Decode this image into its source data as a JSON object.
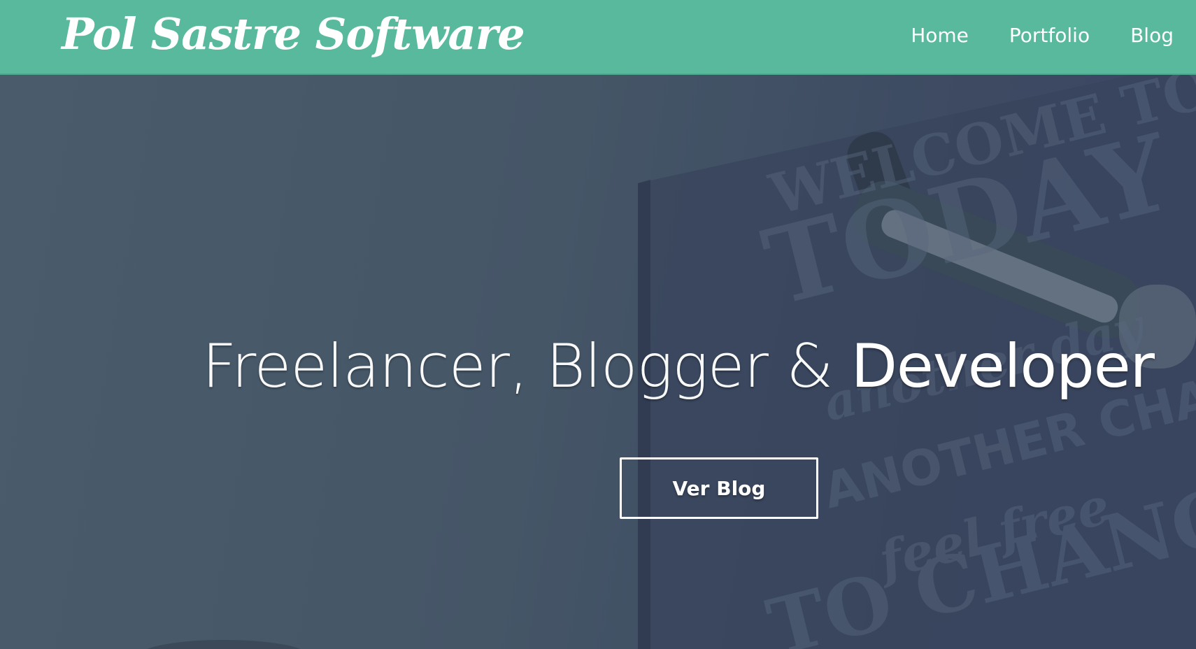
{
  "brand": {
    "name": "Pol Sastre Software"
  },
  "nav": {
    "items": [
      {
        "label": "Home"
      },
      {
        "label": "Portfolio"
      },
      {
        "label": "Blog"
      }
    ]
  },
  "hero": {
    "headline_part1": "Freelancer, Blogger & ",
    "headline_part2": "Developer",
    "cta_label": "Ver Blog",
    "background_poster_text": [
      "WELCOME TO",
      "TODAY",
      "another day",
      "ANOTHER CHANCE",
      "feel free",
      "TO CHANGE"
    ]
  },
  "colors": {
    "navbar": "#59b99d",
    "hero_overlay": "#47596a",
    "text": "#ffffff"
  }
}
